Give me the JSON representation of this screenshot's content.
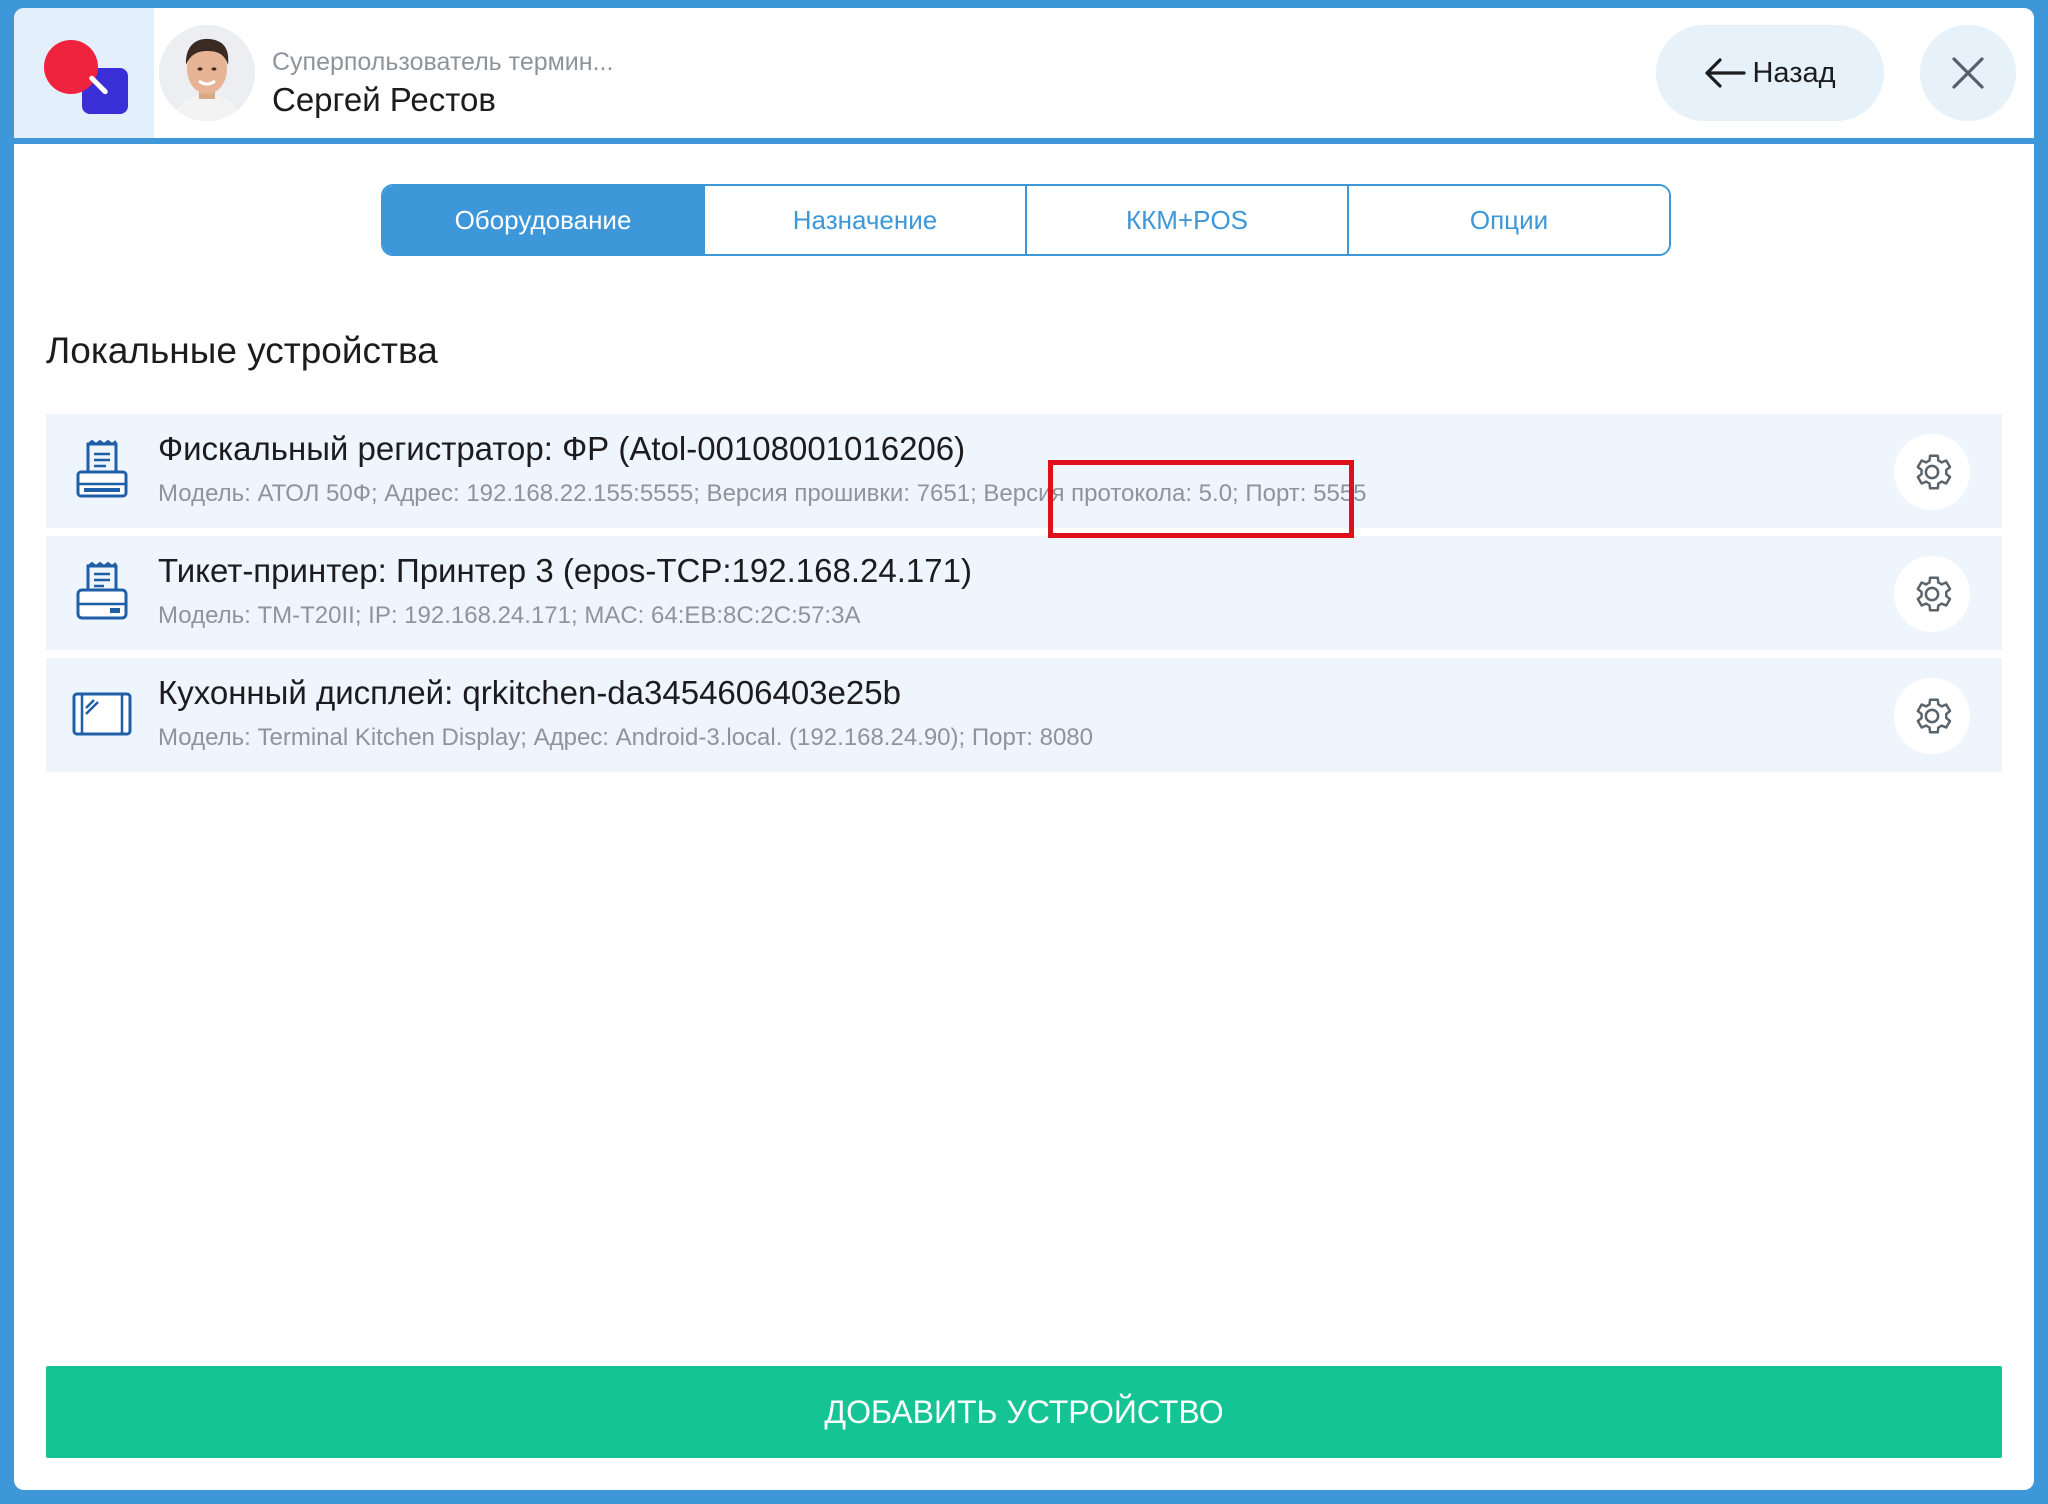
{
  "header": {
    "user_role": "Суперпользователь термин...",
    "user_name": "Сергей Рестов",
    "back_label": "Назад"
  },
  "tabs": [
    {
      "label": "Оборудование",
      "active": true
    },
    {
      "label": "Назначение",
      "active": false
    },
    {
      "label": "ККМ+POS",
      "active": false
    },
    {
      "label": "Опции",
      "active": false
    }
  ],
  "section_title": "Локальные устройства",
  "devices": [
    {
      "icon": "fiscal-register-icon",
      "title": "Фискальный регистратор: ФР (Atol-00108001016206)",
      "details": "Модель: АТОЛ 50Ф; Адрес: 192.168.22.155:5555; Версия прошивки: 7651; Версия протокола: 5.0; Порт: 5555"
    },
    {
      "icon": "ticket-printer-icon",
      "title": "Тикет-принтер: Принтер 3 (epos-TCP:192.168.24.171)",
      "details": "Модель: TM-T20II; IP: 192.168.24.171; MAC: 64:EB:8C:2C:57:3A"
    },
    {
      "icon": "kitchen-display-icon",
      "title": "Кухонный дисплей: qrkitchen-da3454606403e25b",
      "details": "Модель: Terminal Kitchen Display; Адрес: Android-3.local. (192.168.24.90); Порт: 8080"
    }
  ],
  "add_button_label": "ДОБАВИТЬ УСТРОЙСТВО",
  "colors": {
    "accent": "#3d97d8",
    "add_button": "#14c495",
    "highlight": "#e0101a",
    "row_bg": "#eef5fc"
  }
}
